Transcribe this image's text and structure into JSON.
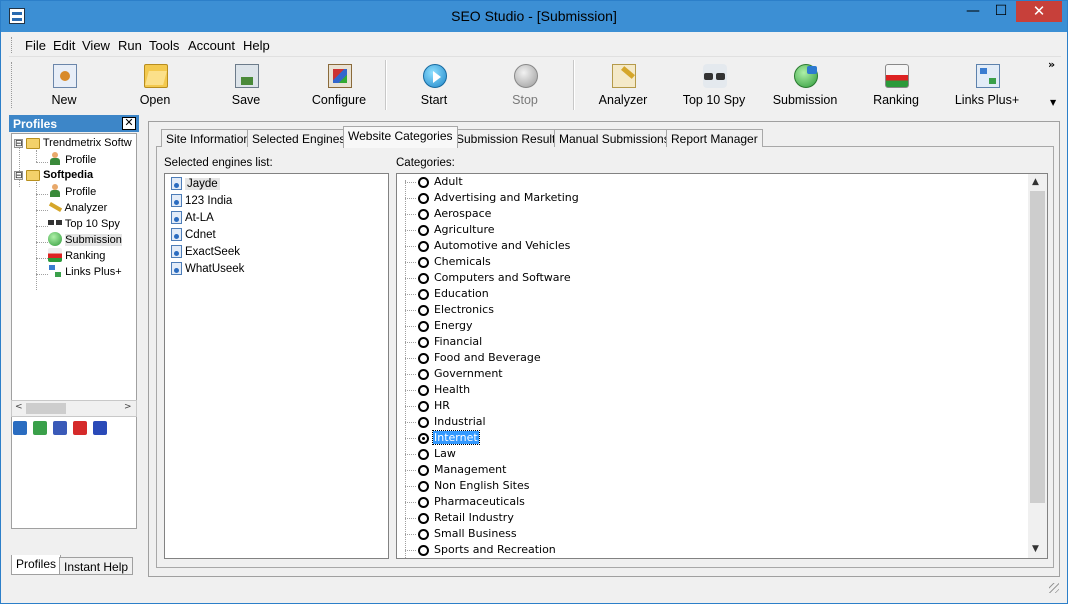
{
  "window": {
    "title": "SEO Studio - [Submission]",
    "min_glyph": "—",
    "max_glyph": "☐",
    "close_glyph": "✕"
  },
  "menu": [
    "File",
    "Edit",
    "View",
    "Run",
    "Tools",
    "Account",
    "Help"
  ],
  "toolbar": {
    "buttons": [
      {
        "label": "New",
        "icon": "new-profile-icon"
      },
      {
        "label": "Open",
        "icon": "open-folder-icon"
      },
      {
        "label": "Save",
        "icon": "save-icon"
      },
      {
        "label": "Configure",
        "icon": "configure-icon"
      },
      {
        "label": "Start",
        "icon": "start-icon"
      },
      {
        "label": "Stop",
        "icon": "stop-icon",
        "disabled": true
      },
      {
        "label": "Analyzer",
        "icon": "analyzer-icon"
      },
      {
        "label": "Top 10 Spy",
        "icon": "spy-icon"
      },
      {
        "label": "Submission",
        "icon": "submission-icon"
      },
      {
        "label": "Ranking",
        "icon": "ranking-icon"
      },
      {
        "label": "Links Plus+",
        "icon": "links-icon"
      }
    ],
    "more_glyph": "»",
    "dropdown_glyph": "▼"
  },
  "profiles": {
    "header": "Profiles",
    "close_glyph": "✕",
    "tree": [
      {
        "label": "Trendmetrix Softw",
        "level": 0,
        "type": "folder",
        "expander": "⊟"
      },
      {
        "label": "Profile",
        "level": 1,
        "type": "profile"
      },
      {
        "label": "Softpedia",
        "level": 0,
        "type": "folder",
        "expander": "⊟",
        "bold": true
      },
      {
        "label": "Profile",
        "level": 1,
        "type": "profile"
      },
      {
        "label": "Analyzer",
        "level": 1,
        "type": "analyzer"
      },
      {
        "label": "Top 10 Spy",
        "level": 1,
        "type": "spy"
      },
      {
        "label": "Submission",
        "level": 1,
        "type": "submission",
        "selected": true
      },
      {
        "label": "Ranking",
        "level": 1,
        "type": "ranking"
      },
      {
        "label": "Links Plus+",
        "level": 1,
        "type": "links"
      }
    ],
    "scroll_left": "<",
    "scroll_right": ">",
    "tabs": [
      "Profiles",
      "Instant Help"
    ]
  },
  "tabs": [
    "Site Information",
    "Selected Engines",
    "Website Categories",
    "Submission Results",
    "Manual Submissions",
    "Report Manager"
  ],
  "active_tab": "Website Categories",
  "engines": {
    "label": "Selected engines list:",
    "items": [
      "Jayde",
      "123 India",
      "At-LA",
      "Cdnet",
      "ExactSeek",
      "WhatUseek"
    ]
  },
  "categories": {
    "label": "Categories:",
    "items": [
      "Adult",
      "Advertising and Marketing",
      "Aerospace",
      "Agriculture",
      "Automotive and Vehicles",
      "Chemicals",
      "Computers and Software",
      "Education",
      "Electronics",
      "Energy",
      "Financial",
      "Food and Beverage",
      "Government",
      "Health",
      "HR",
      "Industrial",
      "Internet",
      "Law",
      "Management",
      "Non English Sites",
      "Pharmaceuticals",
      "Retail Industry",
      "Small Business",
      "Sports and Recreation"
    ],
    "selected": "Internet",
    "scroll_up": "▲",
    "scroll_down": "▼"
  }
}
